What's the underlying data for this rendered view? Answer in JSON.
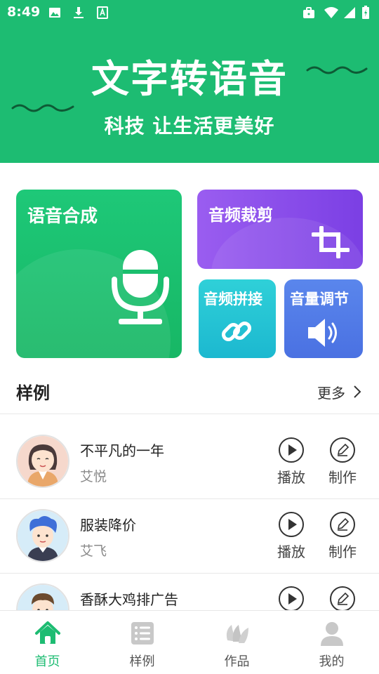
{
  "status_bar": {
    "time": "8:49"
  },
  "banner": {
    "title": "文字转语音",
    "subtitle": "科技  让生活更美好"
  },
  "tools": {
    "tts_label": "语音合成",
    "trim_label": "音频裁剪",
    "join_label": "音频拼接",
    "volume_label": "音量调节"
  },
  "examples": {
    "title": "样例",
    "more": "更多",
    "play_label": "播放",
    "make_label": "制作",
    "items": [
      {
        "title": "不平凡的一年",
        "author": "艾悦"
      },
      {
        "title": "服装降价",
        "author": "艾飞"
      },
      {
        "title": "香酥大鸡排广告",
        "author": ""
      }
    ]
  },
  "bottom_nav": {
    "items": [
      {
        "label": "首页",
        "icon": "home-icon"
      },
      {
        "label": "样例",
        "icon": "list-icon"
      },
      {
        "label": "作品",
        "icon": "works-icon"
      },
      {
        "label": "我的",
        "icon": "user-icon"
      }
    ],
    "active_index": 0
  },
  "colors": {
    "brand": "#1dbc72",
    "purple": "#8a4fea",
    "cyan": "#24c4d4",
    "blue": "#4f78e6"
  }
}
